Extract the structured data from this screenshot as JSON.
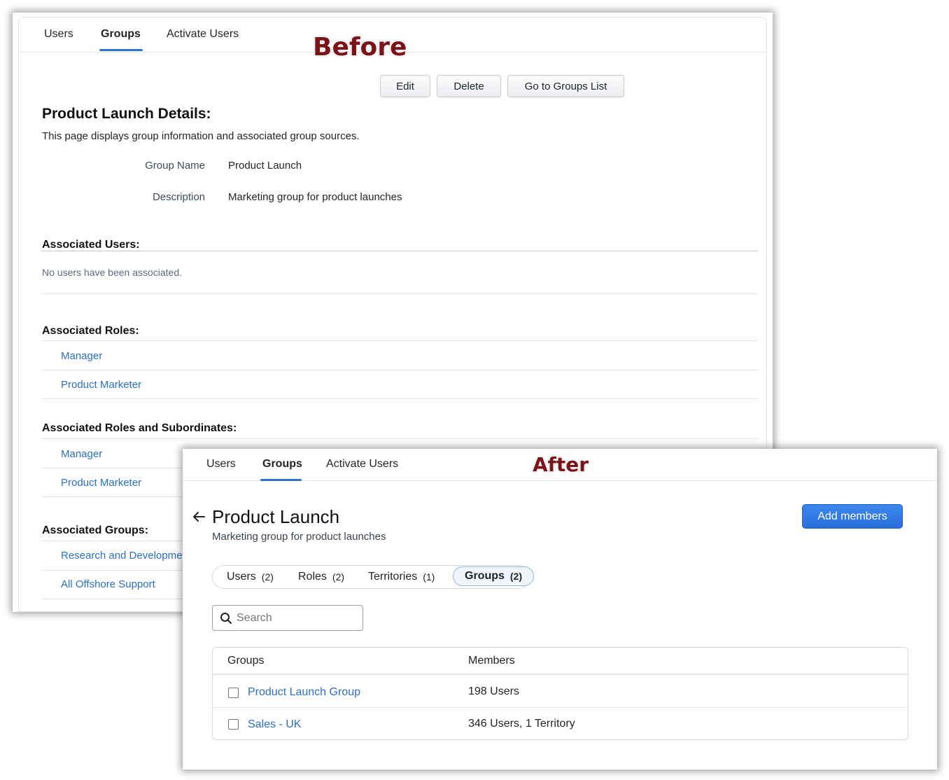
{
  "before": {
    "stamp": "Before",
    "tabs": [
      "Users",
      "Groups",
      "Activate Users"
    ],
    "buttons": {
      "edit": "Edit",
      "delete": "Delete",
      "go_to_list": "Go to Groups List"
    },
    "title": "Product Launch Details:",
    "subtitle": "This page displays group information and associated group sources.",
    "fields": [
      {
        "label": "Group Name",
        "value": "Product Launch"
      },
      {
        "label": "Description",
        "value": "Marketing group for product launches"
      }
    ],
    "associated_users": {
      "heading": "Associated Users:",
      "empty": "No users have been associated."
    },
    "associated_roles": {
      "heading": "Associated Roles:",
      "items": [
        "Manager",
        "Product Marketer"
      ]
    },
    "associated_roles_subs": {
      "heading": "Associated Roles and Subordinates:",
      "items": [
        "Manager",
        "Product Marketer"
      ]
    },
    "associated_groups": {
      "heading": "Associated Groups:",
      "items": [
        "Research and Development",
        "All Offshore Support"
      ]
    }
  },
  "after": {
    "stamp": "After",
    "tabs": [
      "Users",
      "Groups",
      "Activate Users"
    ],
    "title": "Product Launch",
    "subtitle": "Marketing group for product launches",
    "add_members": "Add members",
    "pills": [
      {
        "label": "Users",
        "count": "(2)"
      },
      {
        "label": "Roles",
        "count": "(2)"
      },
      {
        "label": "Territories",
        "count": "(1)"
      },
      {
        "label": "Groups",
        "count": "(2)"
      }
    ],
    "search_placeholder": "Search",
    "table": {
      "headers": [
        "Groups",
        "Members"
      ],
      "rows": [
        {
          "name": "Product Launch Group",
          "members": "198 Users"
        },
        {
          "name": "Sales - UK",
          "members": "346 Users, 1 Territory"
        }
      ]
    }
  },
  "colors": {
    "accent": "#2c74d4",
    "link": "#2b6fc7",
    "stamp": "#7a1418",
    "primary_button": "#2f7ae5"
  },
  "icons": [
    "back-arrow-icon",
    "search-icon",
    "checkbox-icon"
  ]
}
